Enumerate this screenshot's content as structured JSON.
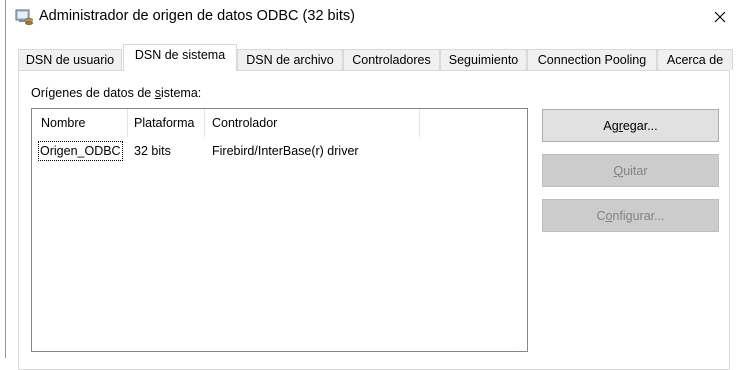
{
  "window": {
    "title": "Administrador de origen de datos ODBC (32 bits)",
    "icon": "odbc-administrator-icon",
    "close_glyph": "✕"
  },
  "tabs": [
    {
      "label": "DSN de usuario",
      "active": false
    },
    {
      "label": "DSN de sistema",
      "active": true
    },
    {
      "label": "DSN de archivo",
      "active": false
    },
    {
      "label": "Controladores",
      "active": false
    },
    {
      "label": "Seguimiento",
      "active": false
    },
    {
      "label": "Connection Pooling",
      "active": false
    },
    {
      "label": "Acerca de",
      "active": false
    }
  ],
  "group": {
    "label_pre": "Orígenes de datos de ",
    "label_mnemonic": "s",
    "label_post": "istema:"
  },
  "list": {
    "columns": [
      "Nombre",
      "Plataforma",
      "Controlador"
    ],
    "rows": [
      {
        "name": "Origen_ODBC",
        "platform": "32 bits",
        "driver": "Firebird/InterBase(r) driver",
        "focused": true
      }
    ]
  },
  "buttons": {
    "add": {
      "pre": "Ag",
      "mnemonic": "r",
      "post": "egar...",
      "enabled": true
    },
    "remove": {
      "pre": "",
      "mnemonic": "Q",
      "post": "uitar",
      "enabled": false
    },
    "configure": {
      "pre": "C",
      "mnemonic": "o",
      "post": "nfigurar...",
      "enabled": false
    }
  },
  "colors": {
    "button_face": "#e1e1e1",
    "button_disabled": "#cccccc",
    "disabled_text": "#838383",
    "list_border": "#828790"
  }
}
